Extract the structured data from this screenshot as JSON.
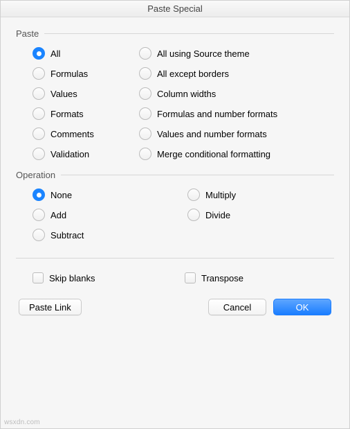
{
  "title": "Paste Special",
  "paste": {
    "groupLabel": "Paste",
    "options": {
      "all": "All",
      "formulas": "Formulas",
      "values": "Values",
      "formats": "Formats",
      "comments": "Comments",
      "validation": "Validation",
      "allSourceTheme": "All using Source theme",
      "allExceptBorders": "All except borders",
      "columnWidths": "Column widths",
      "formulasNumFmts": "Formulas and number formats",
      "valuesNumFmts": "Values and number formats",
      "mergeCondFmt": "Merge conditional formatting"
    },
    "selected": "all"
  },
  "operation": {
    "groupLabel": "Operation",
    "options": {
      "none": "None",
      "add": "Add",
      "subtract": "Subtract",
      "multiply": "Multiply",
      "divide": "Divide"
    },
    "selected": "none"
  },
  "checks": {
    "skipBlanks": "Skip blanks",
    "transpose": "Transpose"
  },
  "buttons": {
    "pasteLink": "Paste Link",
    "cancel": "Cancel",
    "ok": "OK"
  },
  "watermark": "wsxdn.com"
}
